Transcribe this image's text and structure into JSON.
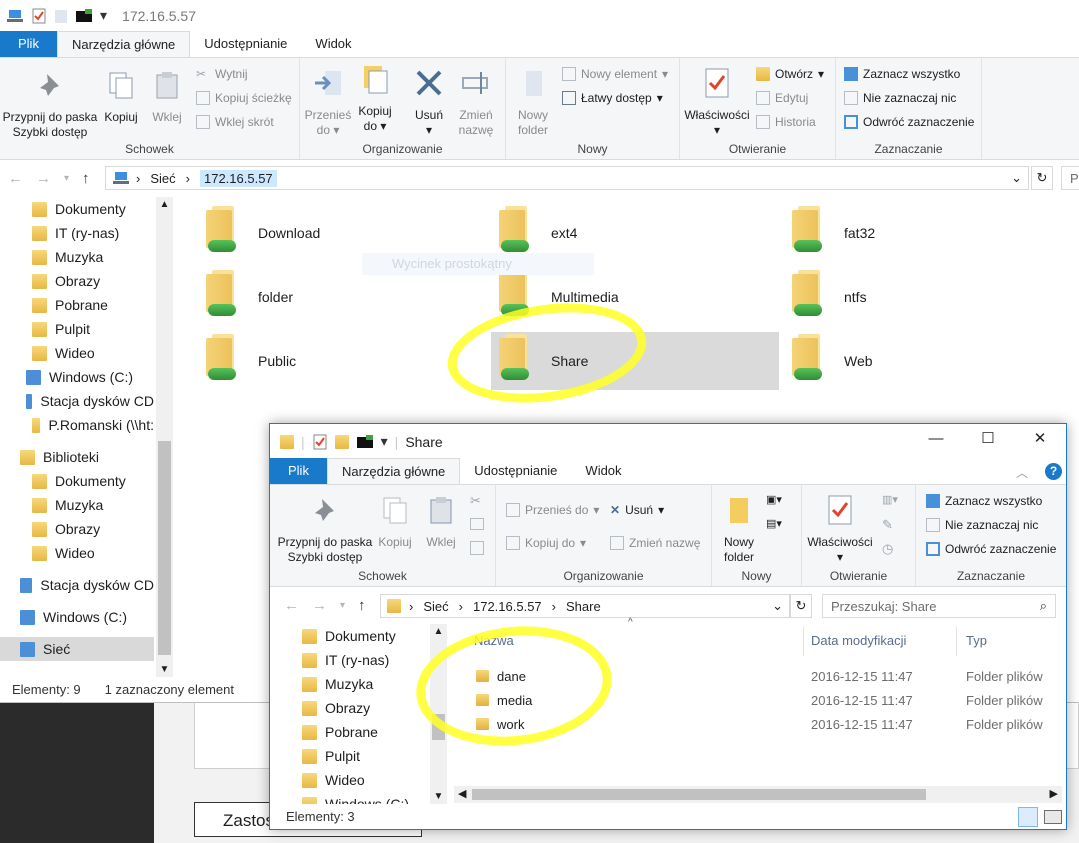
{
  "bg": {
    "button_label": "Zastos"
  },
  "w1": {
    "title_path": "172.16.5.57",
    "tabs": [
      "Plik",
      "Narzędzia główne",
      "Udostępnianie",
      "Widok"
    ],
    "ribbon": {
      "pin_line1": "Przypnij do paska",
      "pin_line2": "Szybki dostęp",
      "copy": "Kopiuj",
      "paste": "Wklej",
      "cut": "Wytnij",
      "copy_path": "Kopiuj ścieżkę",
      "paste_shortcut": "Wklej skrót",
      "group_clipboard": "Schowek",
      "move_to_1": "Przenieś",
      "move_to_2": "do",
      "copy_to_1": "Kopiuj",
      "copy_to_2": "do",
      "delete": "Usuń",
      "rename_1": "Zmień",
      "rename_2": "nazwę",
      "group_organize": "Organizowanie",
      "new_folder_1": "Nowy",
      "new_folder_2": "folder",
      "new_item": "Nowy element",
      "easy_access": "Łatwy dostęp",
      "group_new": "Nowy",
      "properties": "Właściwości",
      "open": "Otwórz",
      "edit": "Edytuj",
      "history": "Historia",
      "group_open": "Otwieranie",
      "select_all": "Zaznacz wszystko",
      "select_none": "Nie zaznaczaj nic",
      "invert": "Odwróć zaznaczenie",
      "group_select": "Zaznaczanie"
    },
    "address": {
      "crumb1": "Sieć",
      "crumb2": "172.16.5.57"
    },
    "nav": [
      {
        "label": "Dokumenty",
        "icon": "documents-icon"
      },
      {
        "label": "IT (ry-nas)",
        "icon": "network-drive-icon"
      },
      {
        "label": "Muzyka",
        "icon": "music-icon"
      },
      {
        "label": "Obrazy",
        "icon": "pictures-icon"
      },
      {
        "label": "Pobrane",
        "icon": "downloads-icon"
      },
      {
        "label": "Pulpit",
        "icon": "desktop-icon"
      },
      {
        "label": "Wideo",
        "icon": "video-icon"
      },
      {
        "label": "Windows (C:)",
        "icon": "drive-icon"
      },
      {
        "label": "Stacja dysków CD",
        "icon": "cd-drive-icon"
      },
      {
        "label": "P.Romanski (\\\\ht:",
        "icon": "network-drive-icon"
      },
      {
        "label": "Biblioteki",
        "icon": "libraries-icon"
      },
      {
        "label": "Dokumenty",
        "icon": "documents-icon"
      },
      {
        "label": "Muzyka",
        "icon": "music-icon"
      },
      {
        "label": "Obrazy",
        "icon": "pictures-icon"
      },
      {
        "label": "Wideo",
        "icon": "video-icon"
      },
      {
        "label": "Stacja dysków CD",
        "icon": "cd-drive-icon"
      },
      {
        "label": "Windows (C:)",
        "icon": "drive-icon"
      },
      {
        "label": "Sieć",
        "icon": "network-icon"
      }
    ],
    "shares": [
      "Download",
      "ext4",
      "fat32",
      "folder",
      "Multimedia",
      "ntfs",
      "Public",
      "Share",
      "Web"
    ],
    "selected_share": "Share",
    "ghost_label": "Wycinek prostokątny",
    "status_items": "Elementy: 9",
    "status_selected": "1 zaznaczony element"
  },
  "w2": {
    "title": "Share",
    "tabs": [
      "Plik",
      "Narzędzia główne",
      "Udostępnianie",
      "Widok"
    ],
    "ribbon": {
      "pin_line1": "Przypnij do paska",
      "pin_line2": "Szybki dostęp",
      "copy": "Kopiuj",
      "paste": "Wklej",
      "group_clipboard": "Schowek",
      "move_to": "Przenieś do",
      "delete": "Usuń",
      "copy_to": "Kopiuj do",
      "rename": "Zmień nazwę",
      "group_organize": "Organizowanie",
      "new_folder_1": "Nowy",
      "new_folder_2": "folder",
      "group_new": "Nowy",
      "properties": "Właściwości",
      "group_open": "Otwieranie",
      "select_all": "Zaznacz wszystko",
      "select_none": "Nie zaznaczaj nic",
      "invert": "Odwróć zaznaczenie",
      "group_select": "Zaznaczanie"
    },
    "address": {
      "crumb1": "Sieć",
      "crumb2": "172.16.5.57",
      "crumb3": "Share"
    },
    "search_placeholder": "Przeszukaj: Share",
    "nav": [
      "Dokumenty",
      "IT (ry-nas)",
      "Muzyka",
      "Obrazy",
      "Pobrane",
      "Pulpit",
      "Wideo",
      "Windows (C:)"
    ],
    "columns": {
      "name": "Nazwa",
      "date": "Data modyfikacji",
      "type": "Typ"
    },
    "files": [
      {
        "name": "dane",
        "date": "2016-12-15 11:47",
        "type": "Folder plików"
      },
      {
        "name": "media",
        "date": "2016-12-15 11:47",
        "type": "Folder plików"
      },
      {
        "name": "work",
        "date": "2016-12-15 11:47",
        "type": "Folder plików"
      }
    ],
    "status_items": "Elementy: 3"
  },
  "colors": {
    "accent": "#1979ca",
    "highlight": "#ffff22",
    "selection": "#dadada"
  }
}
